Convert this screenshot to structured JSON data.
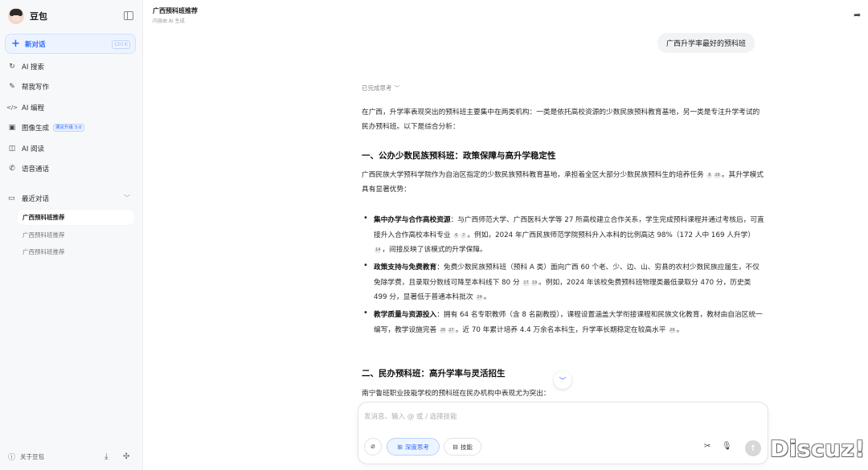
{
  "app": {
    "name": "豆包"
  },
  "sidebar": {
    "new_chat_label": "新对话",
    "new_chat_shortcut": "Ctrl K",
    "nav": [
      {
        "label": "AI 搜索",
        "icon": "ai-search-icon"
      },
      {
        "label": "帮我写作",
        "icon": "writing-icon"
      },
      {
        "label": "AI 编程",
        "icon": "code-icon"
      },
      {
        "label": "图像生成",
        "icon": "image-icon",
        "badge": "满足升级 3.0"
      },
      {
        "label": "AI 阅读",
        "icon": "reading-icon"
      },
      {
        "label": "语音通话",
        "icon": "phone-icon"
      }
    ],
    "recent_label": "最近对话",
    "history": [
      "广西预科班推荐",
      "广西预科班推荐",
      "广西预科班推荐"
    ],
    "about_label": "关于豆包"
  },
  "header": {
    "title": "广西预科班推荐",
    "subtitle": "内容由 AI 生成"
  },
  "user_message": "广西升学率最好的预科班",
  "answer": {
    "thinking_label": "已完成思考",
    "intro": "在广西，升学率表现突出的预科班主要集中在两类机构：一类是依托高校资源的少数民族预科教育基地，另一类是专注升学考试的民办预科班。以下是综合分析：",
    "h1": "一、公办少数民族预科班：政策保障与高升学稳定性",
    "p1": "广西民族大学预科学院作为自治区指定的少数民族预科教育基地，承担着全区大部分少数民族预科生的培养任务",
    "p1_refs": [
      "8",
      "26"
    ],
    "p1_end": "。其升学模式具有显著优势：",
    "items": [
      {
        "title": "集中办学与合作高校资源",
        "text1": "：与广西师范大学、广西医科大学等 27 所高校建立合作关系，学生完成预科课程并通过考核后，可直接升入合作高校本科专业",
        "refs1": [
          "6",
          "7"
        ],
        "text2": "。例如，2024 年广西民族师范学院预科升入本科的比例高达 98%（172 人中 169 人升学）",
        "refs2": [
          "14"
        ],
        "text3": "，间接反映了该模式的升学保障。"
      },
      {
        "title": "政策支持与免费教育",
        "text1": "：免费少数民族预科班（预科 A 类）面向广西 60 个老、少、边、山、穷县的农村少数民族应届生，不仅免除学费，且录取分数线可降至本科线下 80 分",
        "refs1": [
          "17",
          "19"
        ],
        "text2": "。例如，2024 年该校免费预科班物理类最低录取分 470 分，历史类 499 分，显著低于普通本科批次",
        "refs2": [
          "24"
        ],
        "text3": "。"
      },
      {
        "title": "教学质量与资源投入",
        "text1": "：拥有 64 名专职教师（含 8 名副教授），课程设置涵盖大学衔接课程和民族文化教育，教材由自治区统一编写，教学设施完善",
        "refs1": [
          "26",
          "27"
        ],
        "text2": "。近 70 年累计培养 4.4 万余名本科生，升学率长期稳定在较高水平",
        "refs2": [
          "26"
        ],
        "text3": "。"
      }
    ],
    "h2": "二、民办预科班：高升学率与灵活招生",
    "p2": "南宁鲁班职业技能学校的预科班在民办机构中表现尤为突出："
  },
  "input": {
    "placeholder": "发消息、输入 @ 或 / 选择技能",
    "deep_think_label": "深度思考",
    "skill_label": "技能"
  },
  "watermark": "Discuz!"
}
